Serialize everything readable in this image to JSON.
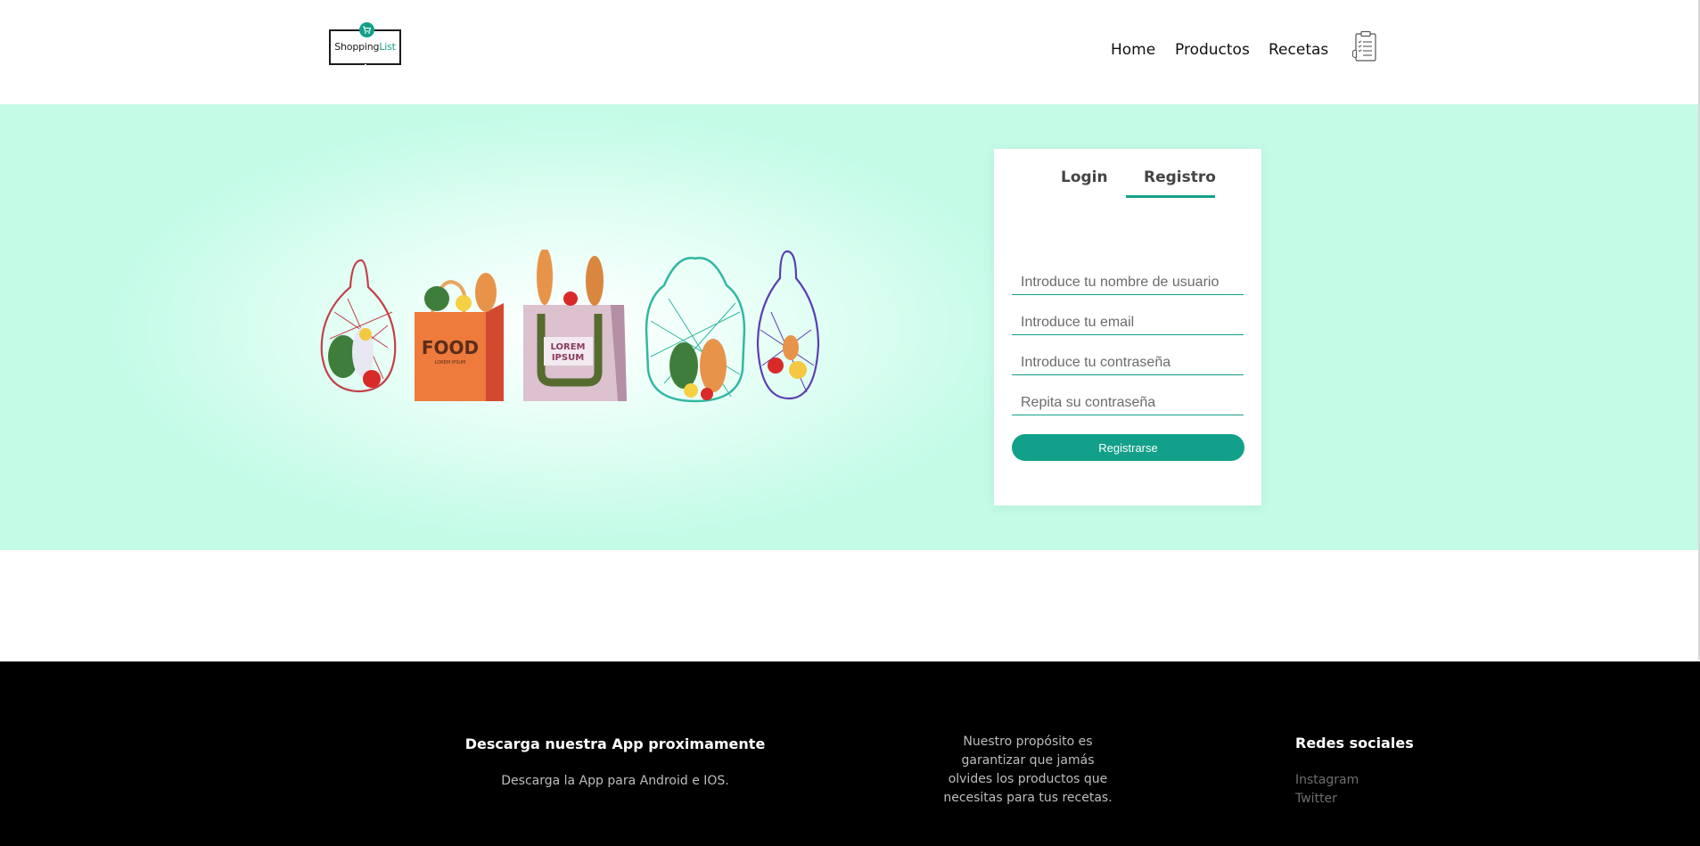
{
  "brand": {
    "logo_text_1": "Shopping",
    "logo_text_2": "List",
    "accent_color": "#13a08a"
  },
  "nav": {
    "items": [
      {
        "label": "Home"
      },
      {
        "label": "Productos"
      },
      {
        "label": "Recetas"
      }
    ],
    "list_icon": "clipboard-list-icon"
  },
  "hero": {
    "illustration": "grocery-bags-illustration",
    "bag_labels": [
      "FOOD",
      "LOREM IPSUM",
      "LOREM",
      "IPSUM"
    ],
    "background_color": "#c3fbe7"
  },
  "auth": {
    "tabs": [
      {
        "label": "Login",
        "active": false
      },
      {
        "label": "Registro",
        "active": true
      }
    ],
    "fields": {
      "username_placeholder": "Introduce tu nombre de usuario",
      "email_placeholder": "Introduce tu email",
      "password_placeholder": "Introduce tu contraseña",
      "password_repeat_placeholder": "Repita su contraseña"
    },
    "submit_label": "Registrarse"
  },
  "footer": {
    "app_title": "Descarga nuestra App proximamente",
    "app_text": "Descarga la App para Android e IOS.",
    "purpose_text_line1": "Nuestro propósito es",
    "purpose_text_line2": "garantizar que jamás",
    "purpose_text_line3": "olvides los productos que",
    "purpose_text_line4": "necesitas para tus recetas.",
    "social_title": "Redes sociales",
    "social_links": [
      {
        "label": "Instagram"
      },
      {
        "label": "Twitter"
      }
    ]
  }
}
